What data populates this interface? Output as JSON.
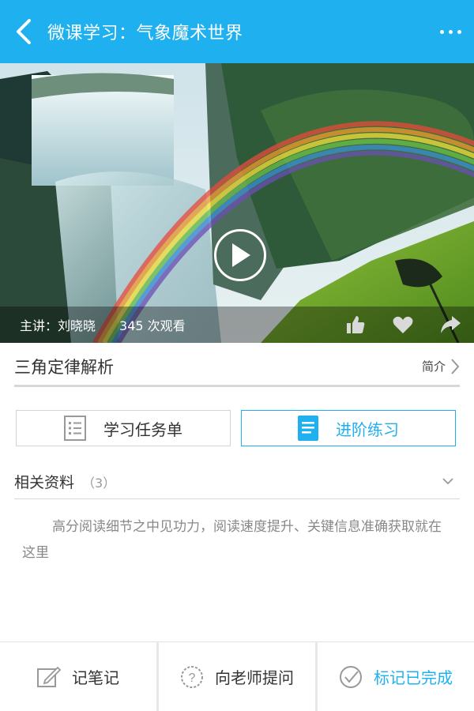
{
  "header": {
    "title": "微课学习：气象魔术世界",
    "back_icon": "chevron-left-icon",
    "more_icon": "more-dots-icon",
    "color": "#1fb0ef"
  },
  "video": {
    "lecturer": "主讲：刘晓晓",
    "views": "345 次观看",
    "play_icon": "play-icon",
    "actions": [
      "thumbs-up-icon",
      "heart-icon",
      "share-icon"
    ]
  },
  "lesson": {
    "title": "三角定律解析",
    "intro_label": "简介"
  },
  "tabs": [
    {
      "label": "学习任务单",
      "icon": "list-icon",
      "active": false
    },
    {
      "label": "进阶练习",
      "icon": "document-icon",
      "active": true
    }
  ],
  "related": {
    "label": "相关资料",
    "count": "（3）"
  },
  "description": "高分阅读细节之中见功力，阅读速度提升、关键信息准确获取就在这里",
  "bottom_bar": [
    {
      "label": "记笔记",
      "icon": "note-edit-icon"
    },
    {
      "label": "向老师提问",
      "icon": "question-icon"
    },
    {
      "label": "标记已完成",
      "icon": "check-circle-icon"
    }
  ]
}
